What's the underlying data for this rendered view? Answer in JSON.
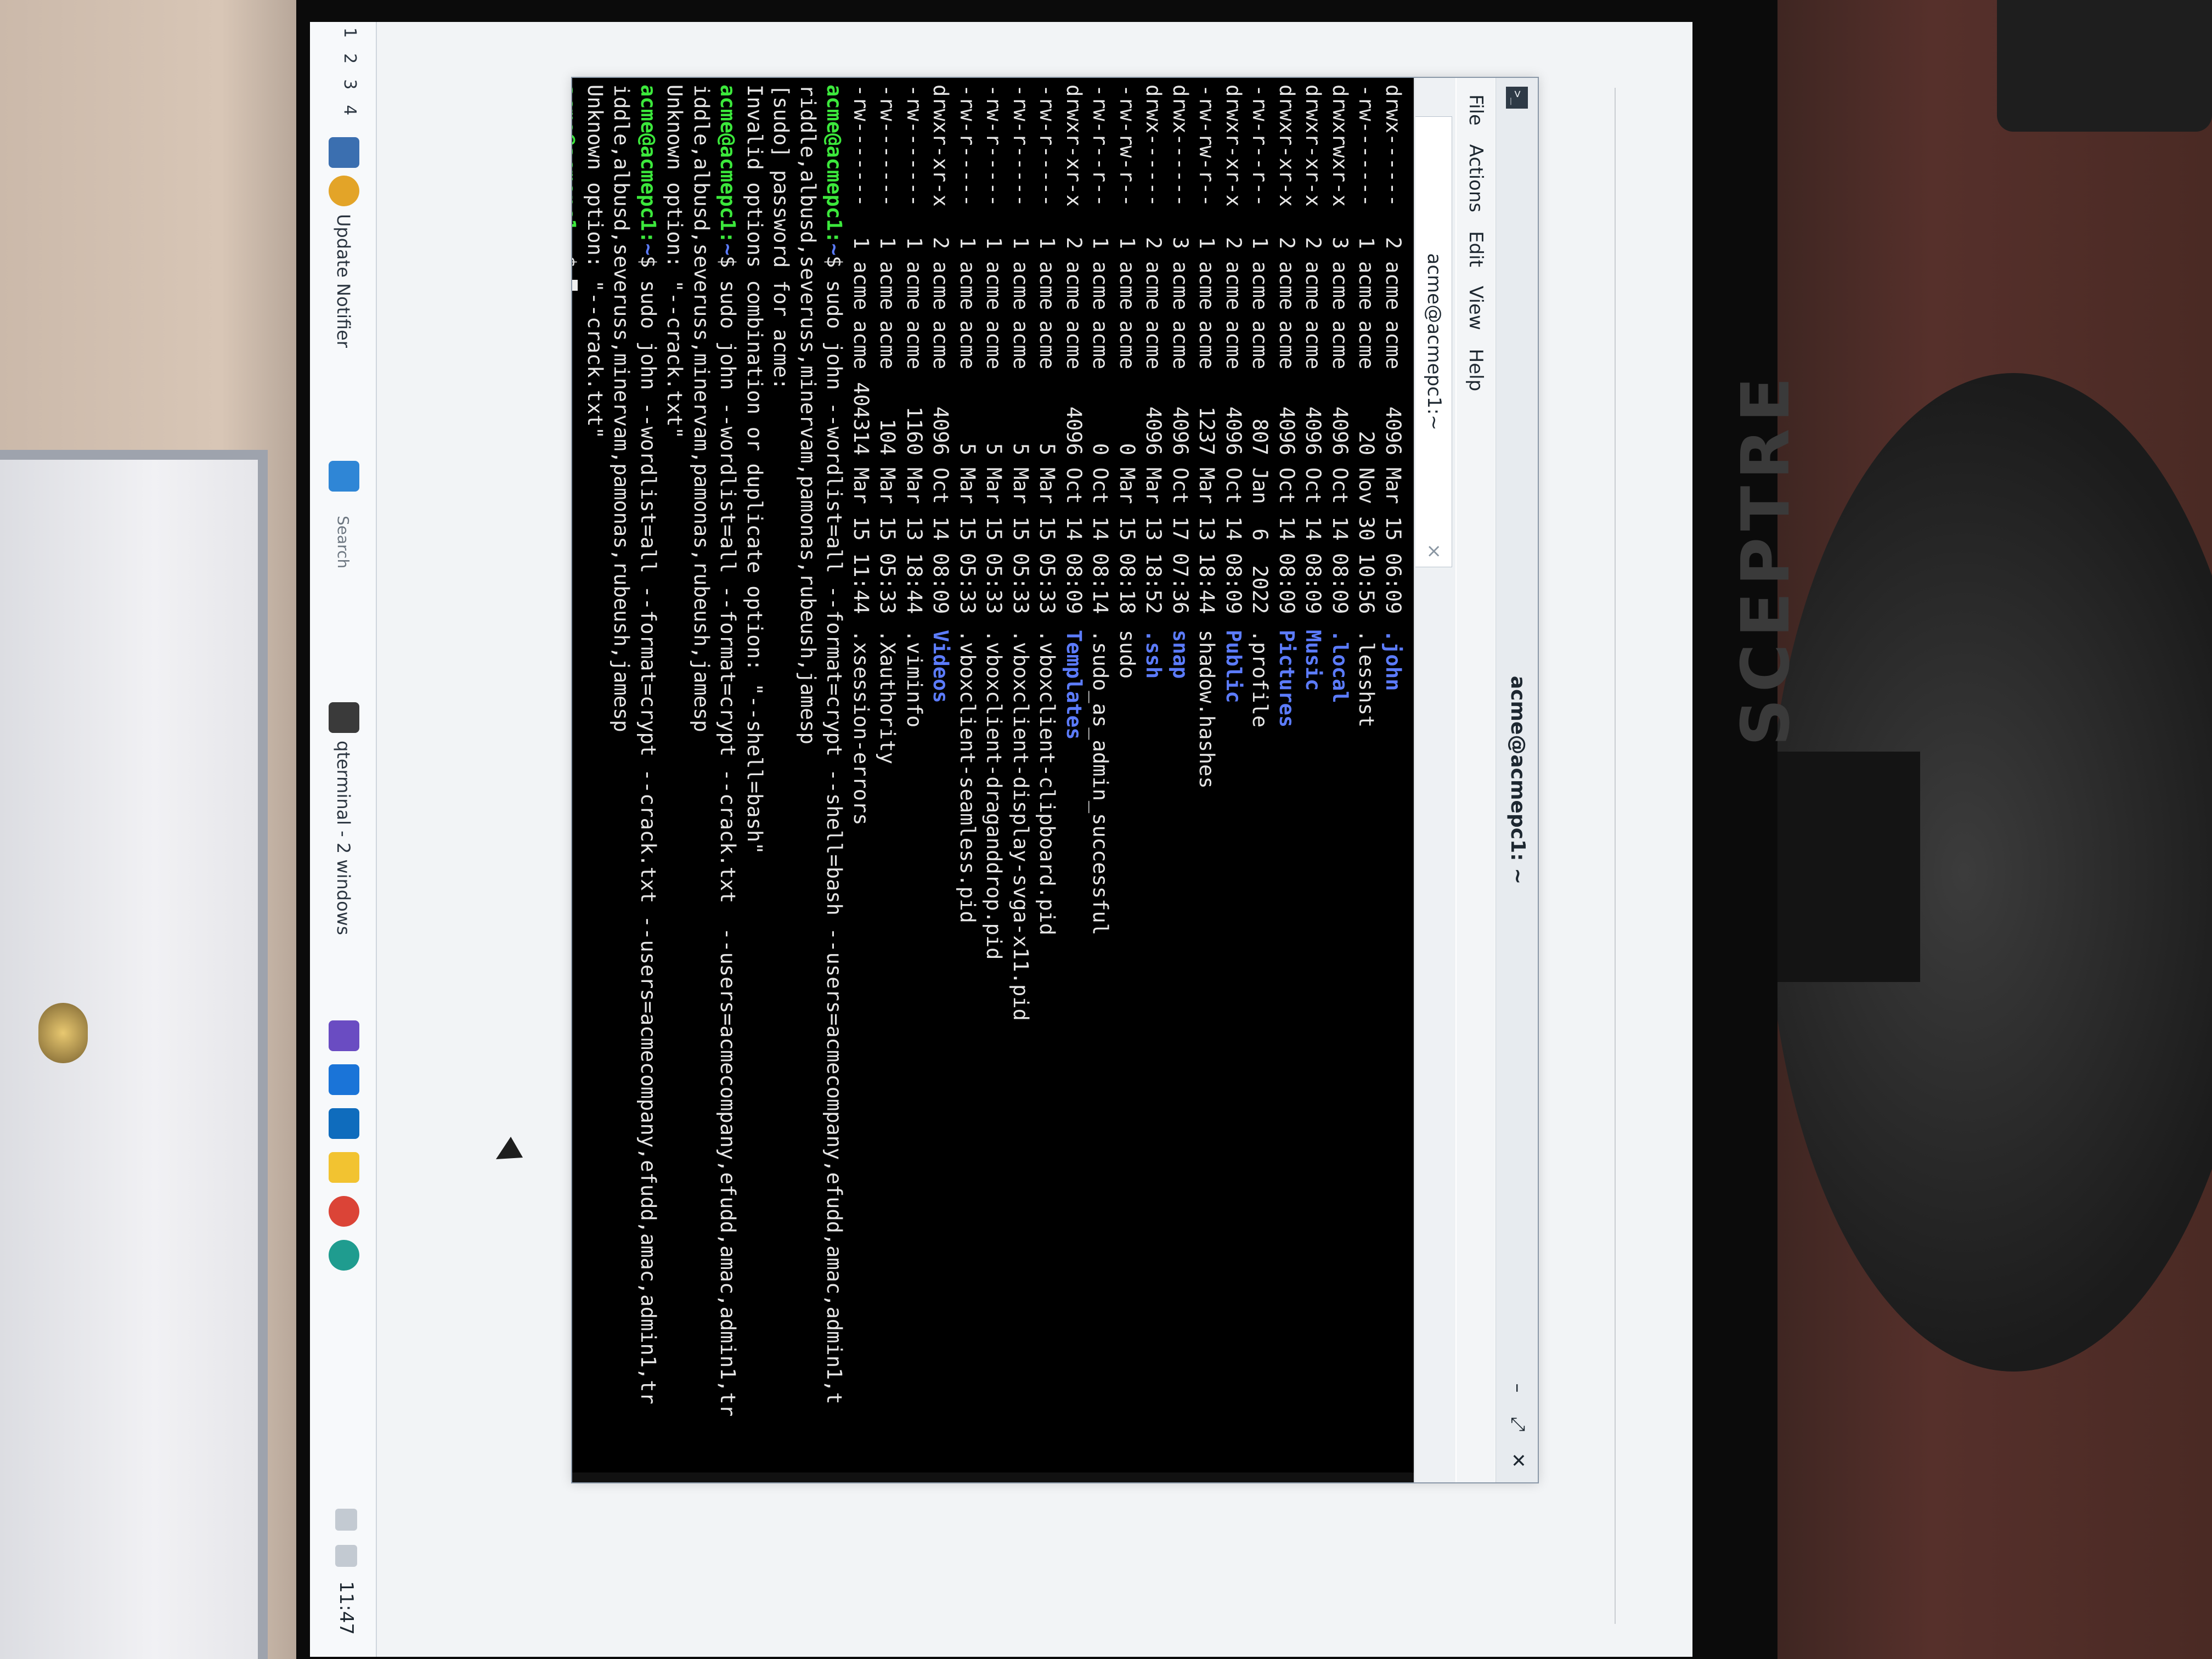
{
  "window": {
    "title": "acme@acmepc1: ~",
    "controls": [
      "–",
      "⤢",
      "✕"
    ]
  },
  "menu": [
    "File",
    "Actions",
    "Edit",
    "View",
    "Help"
  ],
  "tab": {
    "label": "acme@acmepc1:~",
    "close": "×"
  },
  "listing": [
    {
      "perm": "drwx------",
      "links": "2",
      "owner": "acme",
      "group": "acme",
      "size": "4096",
      "date": "Mar 15 06:09",
      "name": ".john",
      "dir": true
    },
    {
      "perm": "-rw-------",
      "links": "1",
      "owner": "acme",
      "group": "acme",
      "size": "20",
      "date": "Nov 30 10:56",
      "name": ".lesshst",
      "dir": false
    },
    {
      "perm": "drwxrwxr-x",
      "links": "3",
      "owner": "acme",
      "group": "acme",
      "size": "4096",
      "date": "Oct 14 08:09",
      "name": ".local",
      "dir": true
    },
    {
      "perm": "drwxr-xr-x",
      "links": "2",
      "owner": "acme",
      "group": "acme",
      "size": "4096",
      "date": "Oct 14 08:09",
      "name": "Music",
      "dir": true
    },
    {
      "perm": "drwxr-xr-x",
      "links": "2",
      "owner": "acme",
      "group": "acme",
      "size": "4096",
      "date": "Oct 14 08:09",
      "name": "Pictures",
      "dir": true
    },
    {
      "perm": "-rw-r--r--",
      "links": "1",
      "owner": "acme",
      "group": "acme",
      "size": "807",
      "date": "Jan  6  2022",
      "name": ".profile",
      "dir": false
    },
    {
      "perm": "drwxr-xr-x",
      "links": "2",
      "owner": "acme",
      "group": "acme",
      "size": "4096",
      "date": "Oct 14 08:09",
      "name": "Public",
      "dir": true
    },
    {
      "perm": "-rw-rw-r--",
      "links": "1",
      "owner": "acme",
      "group": "acme",
      "size": "1237",
      "date": "Mar 13 18:44",
      "name": "shadow.hashes",
      "dir": false
    },
    {
      "perm": "drwx------",
      "links": "3",
      "owner": "acme",
      "group": "acme",
      "size": "4096",
      "date": "Oct 17 07:36",
      "name": "snap",
      "dir": true
    },
    {
      "perm": "drwx------",
      "links": "2",
      "owner": "acme",
      "group": "acme",
      "size": "4096",
      "date": "Mar 13 18:52",
      "name": ".ssh",
      "dir": true
    },
    {
      "perm": "-rw-rw-r--",
      "links": "1",
      "owner": "acme",
      "group": "acme",
      "size": "0",
      "date": "Mar 15 08:18",
      "name": "sudo",
      "dir": false
    },
    {
      "perm": "-rw-r--r--",
      "links": "1",
      "owner": "acme",
      "group": "acme",
      "size": "0",
      "date": "Oct 14 08:14",
      "name": ".sudo_as_admin_successful",
      "dir": false
    },
    {
      "perm": "drwxr-xr-x",
      "links": "2",
      "owner": "acme",
      "group": "acme",
      "size": "4096",
      "date": "Oct 14 08:09",
      "name": "Templates",
      "dir": true
    },
    {
      "perm": "-rw-r-----",
      "links": "1",
      "owner": "acme",
      "group": "acme",
      "size": "5",
      "date": "Mar 15 05:33",
      "name": ".vboxclient-clipboard.pid",
      "dir": false
    },
    {
      "perm": "-rw-r-----",
      "links": "1",
      "owner": "acme",
      "group": "acme",
      "size": "5",
      "date": "Mar 15 05:33",
      "name": ".vboxclient-display-svga-x11.pid",
      "dir": false
    },
    {
      "perm": "-rw-r-----",
      "links": "1",
      "owner": "acme",
      "group": "acme",
      "size": "5",
      "date": "Mar 15 05:33",
      "name": ".vboxclient-draganddrop.pid",
      "dir": false
    },
    {
      "perm": "-rw-r-----",
      "links": "1",
      "owner": "acme",
      "group": "acme",
      "size": "5",
      "date": "Mar 15 05:33",
      "name": ".vboxclient-seamless.pid",
      "dir": false
    },
    {
      "perm": "drwxr-xr-x",
      "links": "2",
      "owner": "acme",
      "group": "acme",
      "size": "4096",
      "date": "Oct 14 08:09",
      "name": "Videos",
      "dir": true
    },
    {
      "perm": "-rw-------",
      "links": "1",
      "owner": "acme",
      "group": "acme",
      "size": "1160",
      "date": "Mar 13 18:44",
      "name": ".viminfo",
      "dir": false
    },
    {
      "perm": "-rw-------",
      "links": "1",
      "owner": "acme",
      "group": "acme",
      "size": "104",
      "date": "Mar 15 05:33",
      "name": ".Xauthority",
      "dir": false
    },
    {
      "perm": "-rw-------",
      "links": "1",
      "owner": "acme",
      "group": "acme",
      "size": "404314",
      "date": "Mar 15 11:44",
      "name": ".xsession-errors",
      "dir": false
    }
  ],
  "session": [
    {
      "type": "cmd",
      "prompt_user": "acme@acmepc1",
      "prompt_path": "~",
      "text": "sudo john --wordlist=all --format=crypt --shell=bash --users=acmecompany,efudd,amac,admin1,t"
    },
    {
      "type": "out",
      "text": "riddle,albusd,severuss,minervam,pamonas,rubeush,jamesp"
    },
    {
      "type": "out",
      "text": "[sudo] password for acme:"
    },
    {
      "type": "out",
      "text": "Invalid options combination or duplicate option: \"--shell=bash\""
    },
    {
      "type": "cmd",
      "prompt_user": "acme@acmepc1",
      "prompt_path": "~",
      "text": "sudo john --wordlist=all --format=crypt --crack.txt  --users=acmecompany,efudd,amac,admin1,tr"
    },
    {
      "type": "out",
      "text": "iddle,albusd,severuss,minervam,pamonas,rubeush,jamesp"
    },
    {
      "type": "out",
      "text": "Unknown option: \"--crack.txt\""
    },
    {
      "type": "cmd",
      "prompt_user": "acme@acmepc1",
      "prompt_path": "~",
      "text": "sudo john --wordlist=all --format=crypt --crack.txt --users=acmecompany,efudd,amac,admin1,tr"
    },
    {
      "type": "out",
      "text": "iddle,albusd,severuss,minervam,pamonas,rubeush,jamesp"
    },
    {
      "type": "out",
      "text": "Unknown option: \"--crack.txt\""
    },
    {
      "type": "prompt",
      "prompt_user": "acme@acmepc1",
      "prompt_path": "~",
      "text": ""
    }
  ],
  "taskbar": {
    "desktops": [
      "1",
      "2",
      "3",
      "4"
    ],
    "notifier_label": "Update Notifier",
    "task_label": "qterminal - 2 windows",
    "search_placeholder": "Search",
    "clock": "11:47"
  },
  "monitor_brand": "SCEPTRE",
  "colors": {
    "terminal_bg": "#000000",
    "prompt_green": "#3ce83c",
    "dir_blue": "#5c7cff"
  }
}
